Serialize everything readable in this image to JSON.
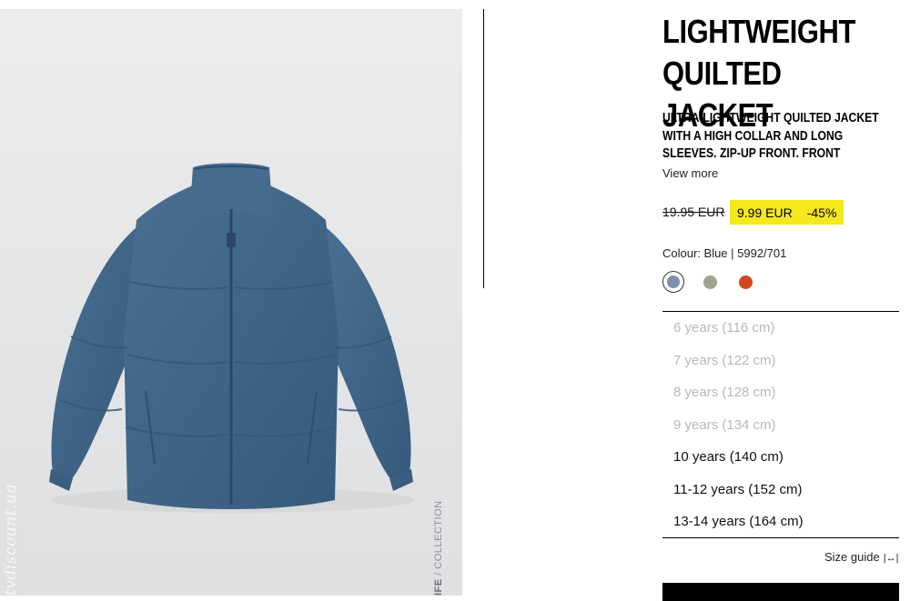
{
  "product": {
    "title": "LIGHTWEIGHT QUILTED JACKET",
    "description": "ULTRA-LIGHTWEIGHT QUILTED JACKET WITH A HIGH COLLAR AND LONG SLEEVES. ZIP-UP FRONT. FRONT",
    "view_more": "View more",
    "old_price": "19.95 EUR",
    "sale_price": "9.99 EUR",
    "discount": "-45%",
    "colour_label": "Colour: Blue | 5992/701",
    "image_alt": "Blue quilted puffer jacket",
    "image_watermark": "tvdiscount.ua",
    "image_label_bold": "IFE",
    "image_label": " / COLLECTION"
  },
  "colours": [
    {
      "name": "Blue",
      "hex": "#7d8fb0",
      "selected": true
    },
    {
      "name": "Sage",
      "hex": "#9fa48e",
      "selected": false
    },
    {
      "name": "Orange red",
      "hex": "#d2461e",
      "selected": false
    }
  ],
  "sizes": [
    {
      "label": "6 years (116 cm)",
      "available": false
    },
    {
      "label": "7 years (122 cm)",
      "available": false
    },
    {
      "label": "8 years (128 cm)",
      "available": false
    },
    {
      "label": "9 years (134 cm)",
      "available": false
    },
    {
      "label": "10 years (140 cm)",
      "available": true
    },
    {
      "label": "11-12 years (152 cm)",
      "available": true
    },
    {
      "label": "13-14 years (164 cm)",
      "available": true
    }
  ],
  "size_guide": {
    "label": "Size guide",
    "icon": "ruler-icon"
  },
  "icons": {
    "size_guide_glyph": "|↔|"
  },
  "colors": {
    "sale_highlight": "#f5e81c",
    "jacket": "#3f6486"
  }
}
